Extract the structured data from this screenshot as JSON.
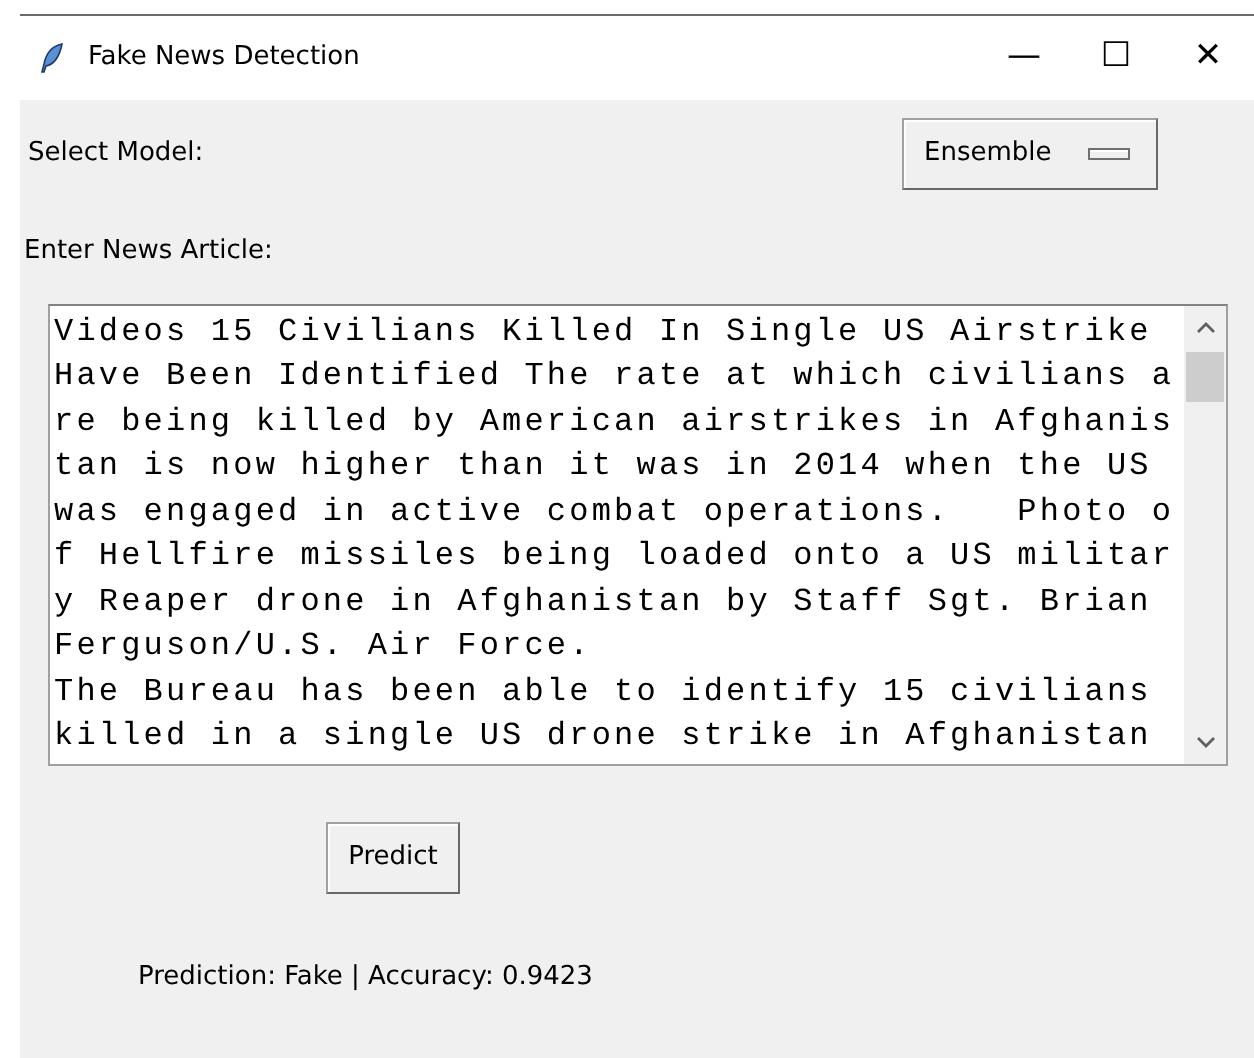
{
  "window": {
    "title": "Fake News Detection",
    "controls": [
      "—",
      "☐",
      "✕"
    ]
  },
  "model": {
    "label": "Select Model:",
    "value": "Ensemble"
  },
  "article": {
    "label": "Enter News Article:",
    "lines": [
      "Videos 15 Civilians Killed In Single US Airstrike",
      "Have Been Identified The rate at which civilians a",
      "re being killed by American airstrikes in Afghanis",
      "tan is now higher than it was in 2014 when the US",
      "was engaged in active combat operations.   Photo o",
      "f Hellfire missiles being loaded onto a US militar",
      "y Reaper drone in Afghanistan by Staff Sgt. Brian",
      "Ferguson/U.S. Air Force.",
      "The Bureau has been able to identify 15 civilians",
      "killed in a single US drone strike in Afghanistan"
    ]
  },
  "predict_button": "Predict",
  "result": "Prediction: Fake | Accuracy: 0.9423"
}
